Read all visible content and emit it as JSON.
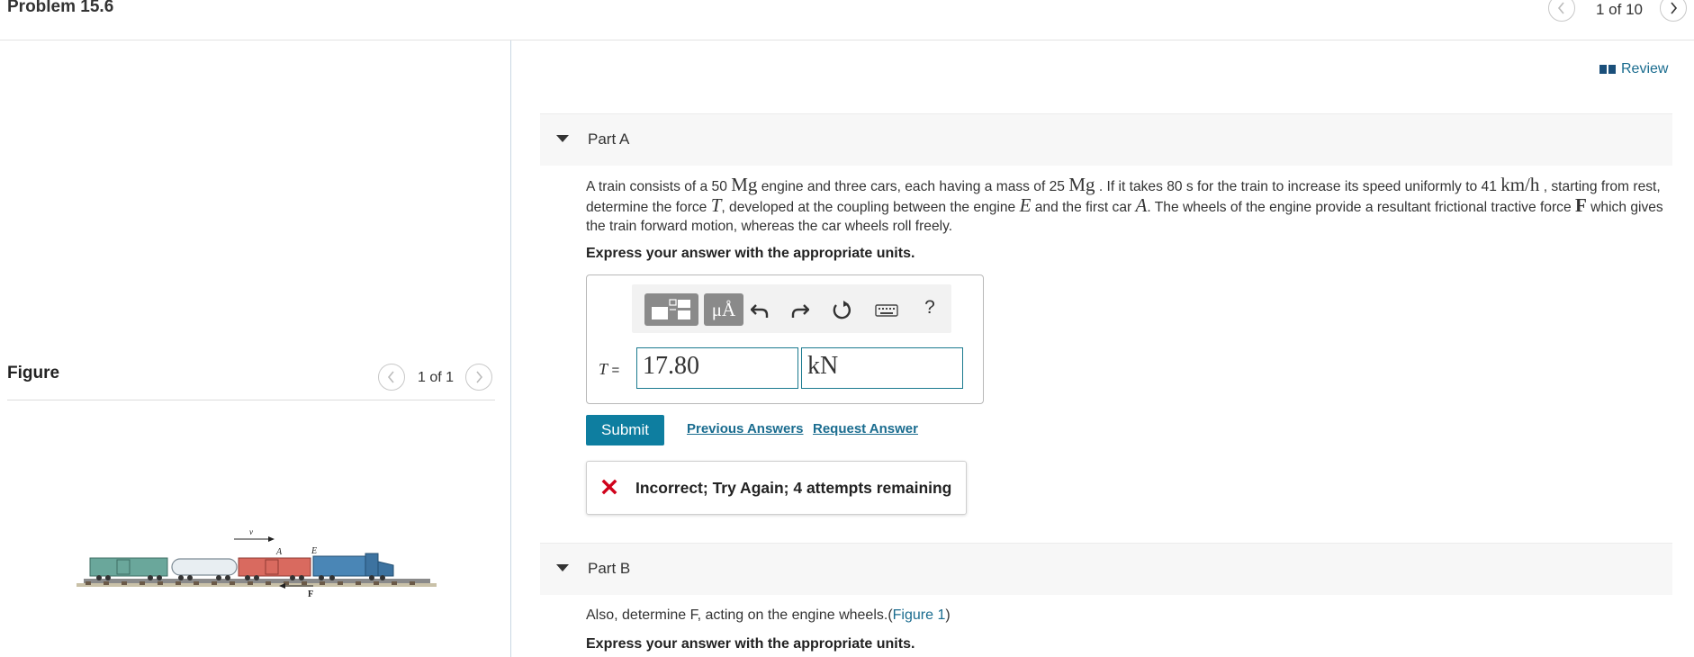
{
  "header": {
    "title": "Problem 15.6",
    "page_indicator": "1 of 10"
  },
  "figure_panel": {
    "heading": "Figure",
    "page_indicator": "1 of 1",
    "labels": {
      "velocity": "v",
      "car": "A",
      "engine": "E",
      "force": "F"
    }
  },
  "review": {
    "label": "Review",
    "icon": "book-icon"
  },
  "part_a": {
    "label": "Part A",
    "text": {
      "s1": "A train consists of a 50 ",
      "u1": "Mg",
      "s2": " engine and three cars, each having a mass of 25 ",
      "u2": "Mg",
      "s3": " . If it takes 80 s for the train to increase its speed uniformly to 41 ",
      "u3": "km/h",
      "s4": " , starting from rest, determine the force ",
      "v_T": "T",
      "s5": ", developed at the coupling between the engine ",
      "v_E": "E",
      "s6": " and the first car ",
      "v_A": "A",
      "s7": ". The wheels of the engine provide a resultant frictional tractive force ",
      "v_F": "F",
      "s8": " which gives the train forward motion, whereas the car wheels roll freely."
    },
    "express": "Express your answer with the appropriate units.",
    "toolbar": {
      "units_label": "μÅ",
      "help_label": "?"
    },
    "answer": {
      "variable": "T",
      "equals": "=",
      "value": "17.80",
      "units": "kN"
    },
    "submit_label": "Submit",
    "previous_answers_label": "Previous Answers",
    "request_answer_label": "Request Answer",
    "feedback": "Incorrect; Try Again; 4 attempts remaining"
  },
  "part_b": {
    "label": "Part B",
    "text": "Also, determine F, acting on the engine wheels.",
    "paren_open": "(",
    "figure_link": "Figure 1",
    "paren_close": ")",
    "express": "Express your answer with the appropriate units."
  },
  "colors": {
    "accent": "#0e7ea0",
    "link": "#1a6c8f",
    "error": "#d0021b"
  }
}
